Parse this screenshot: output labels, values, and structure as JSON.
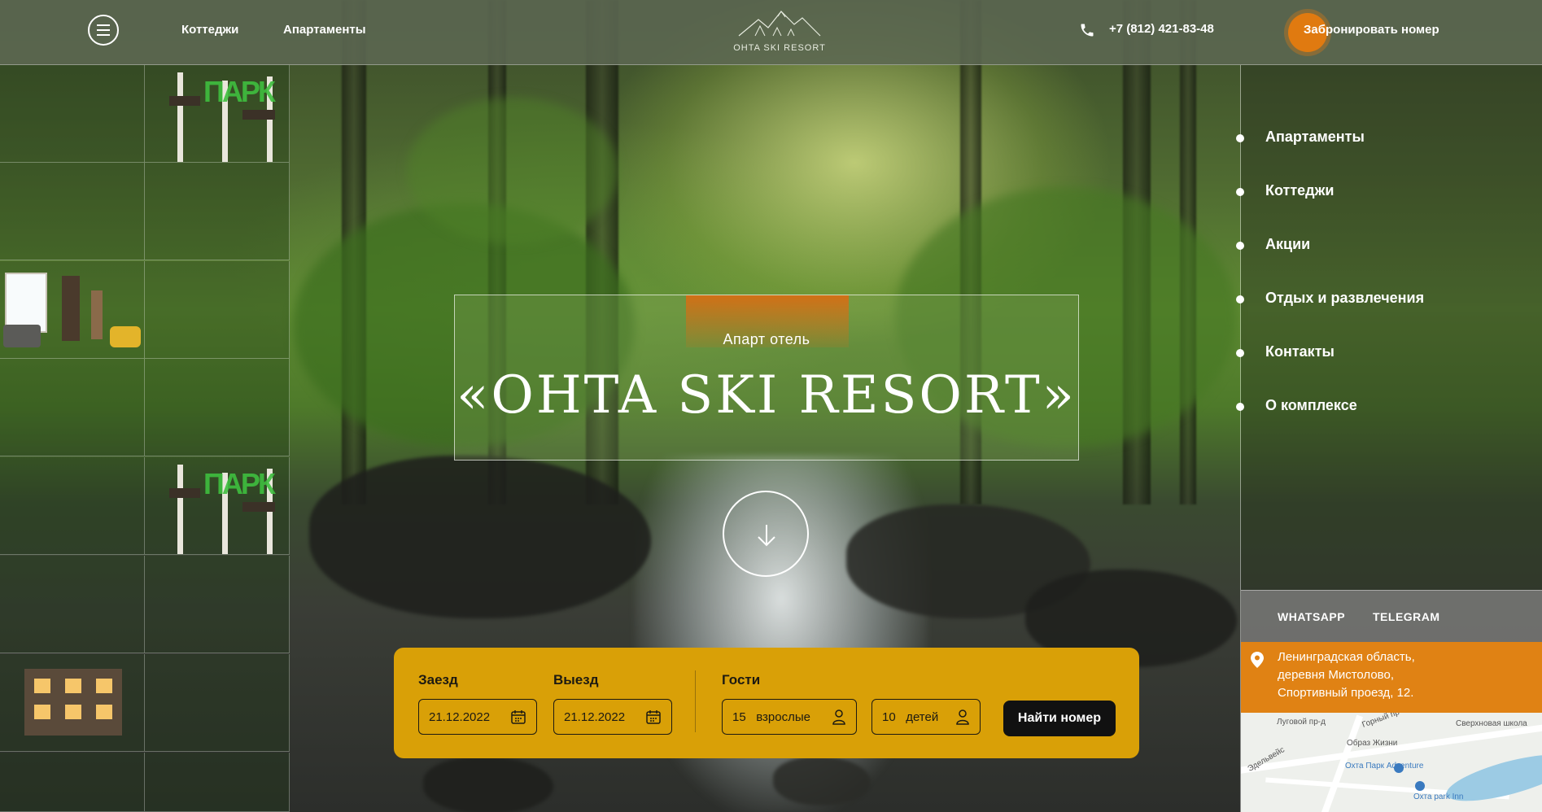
{
  "header": {
    "nav": [
      "Коттеджи",
      "Апартаменты"
    ],
    "logo_text": "OHTA SKI RESORT",
    "phone": "+7 (812) 421-83-48",
    "book_button": "Забронировать номер"
  },
  "hero": {
    "subtitle": "Апарт отель",
    "title": "«OHTA SKI RESORT»"
  },
  "side_menu": [
    {
      "label": "Апартаменты"
    },
    {
      "label": "Коттеджи"
    },
    {
      "label": "Акции"
    },
    {
      "label": "Отдых и развлечения"
    },
    {
      "label": "Контакты"
    },
    {
      "label": "О комплексе"
    }
  ],
  "social": {
    "whatsapp": "WHATSAPP",
    "telegram": "TELEGRAM"
  },
  "address": {
    "line1": "Ленинградская область,",
    "line2": "деревня Мистолово,",
    "line3": "Спортивный проезд, 12."
  },
  "map": {
    "labels": [
      "Луговой пр-д",
      "Горный пр",
      "Сверхновая школа",
      "Образ Жизни",
      "Эдельвейс"
    ],
    "pois": [
      "Охта Парк Adventure",
      "Охта park Inn"
    ]
  },
  "booking": {
    "checkin_label": "Заезд",
    "checkin_value": "21.12.2022",
    "checkout_label": "Выезд",
    "checkout_value": "21.12.2022",
    "guests_label": "Гости",
    "adults_count": "15",
    "adults_unit": "взрослые",
    "children_count": "10",
    "children_unit": "детей",
    "submit": "Найти номер"
  },
  "colors": {
    "accent_orange": "#e07a10",
    "booking_yellow": "#d9a007",
    "header_bg": "#5c6852"
  },
  "icons": [
    "menu-icon",
    "phone-icon",
    "arrow-down-icon",
    "calendar-icon",
    "user-icon",
    "map-pin-icon",
    "mountain-logo-icon"
  ]
}
